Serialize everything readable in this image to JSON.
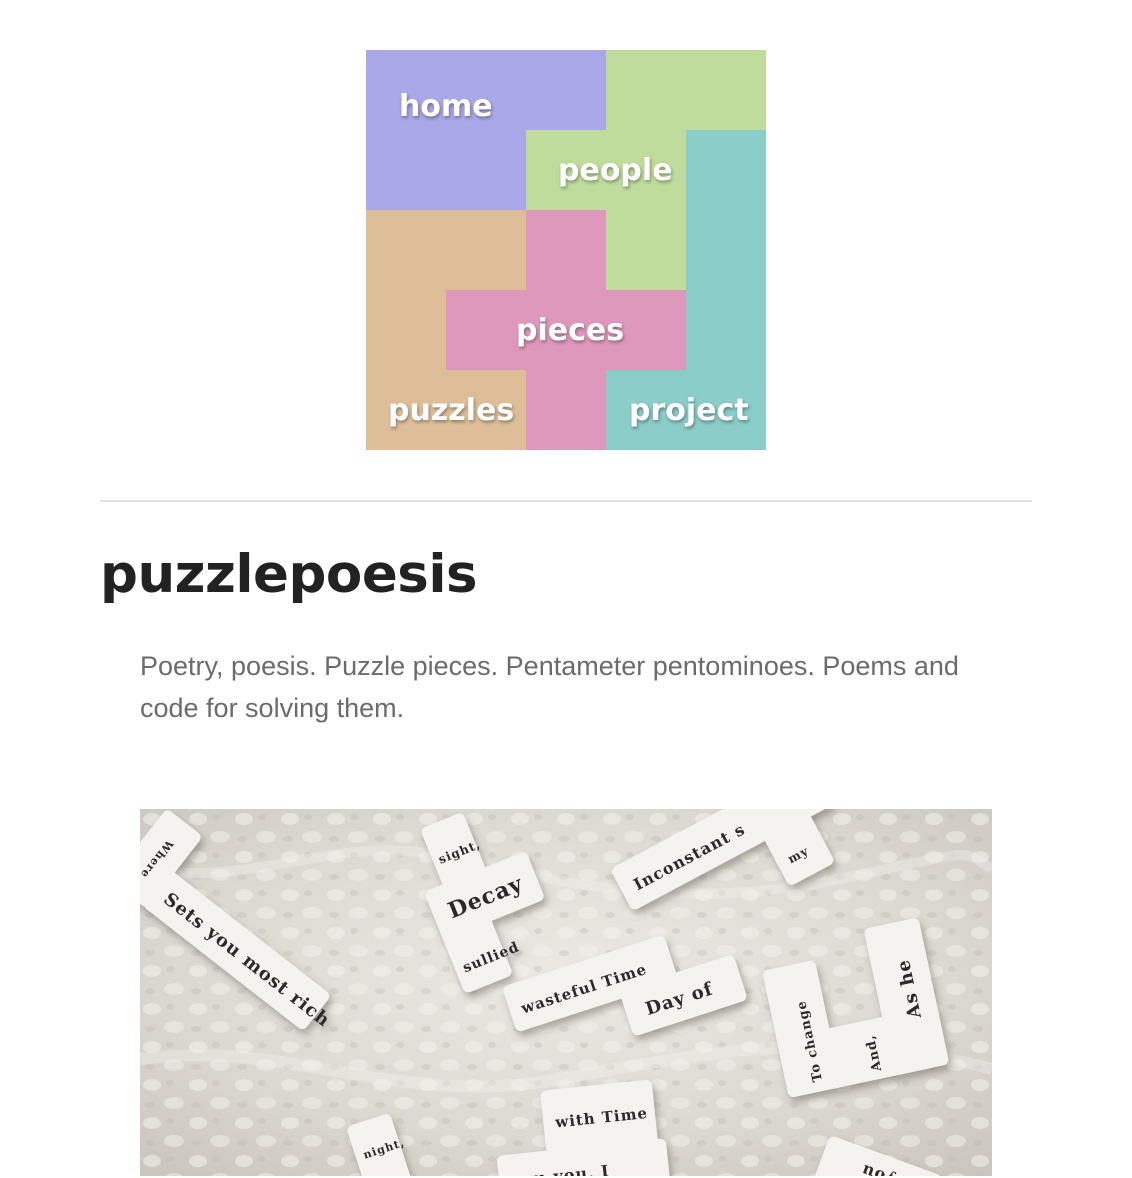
{
  "nav": {
    "home": "home",
    "people": "people",
    "pieces": "pieces",
    "puzzles": "puzzles",
    "project": "project",
    "colors": {
      "home": "#aaa8e8",
      "people": "#bfdc9c",
      "project": "#8bcdc9",
      "puzzles": "#ddbe99",
      "pieces": "#de98bb"
    }
  },
  "site_title": "puzzlepoesis",
  "tagline": "Poetry, poesis. Puzzle pieces. Pentameter pentominoes. Poems and code for solving them.",
  "hero": {
    "tiles": {
      "t1": "Sets you most rich",
      "t2": "Where",
      "t3": "sight,",
      "t4": "Decay",
      "t5": "sullied",
      "t6": "Inconstant s",
      "t7": "my",
      "t8": "wasteful Time",
      "t9": "Day of",
      "t10": "To change",
      "t11": "And,",
      "t12": "As he",
      "t13": "with Time",
      "t14": "m you, I",
      "t15": "night,",
      "t16": "you"
    }
  }
}
